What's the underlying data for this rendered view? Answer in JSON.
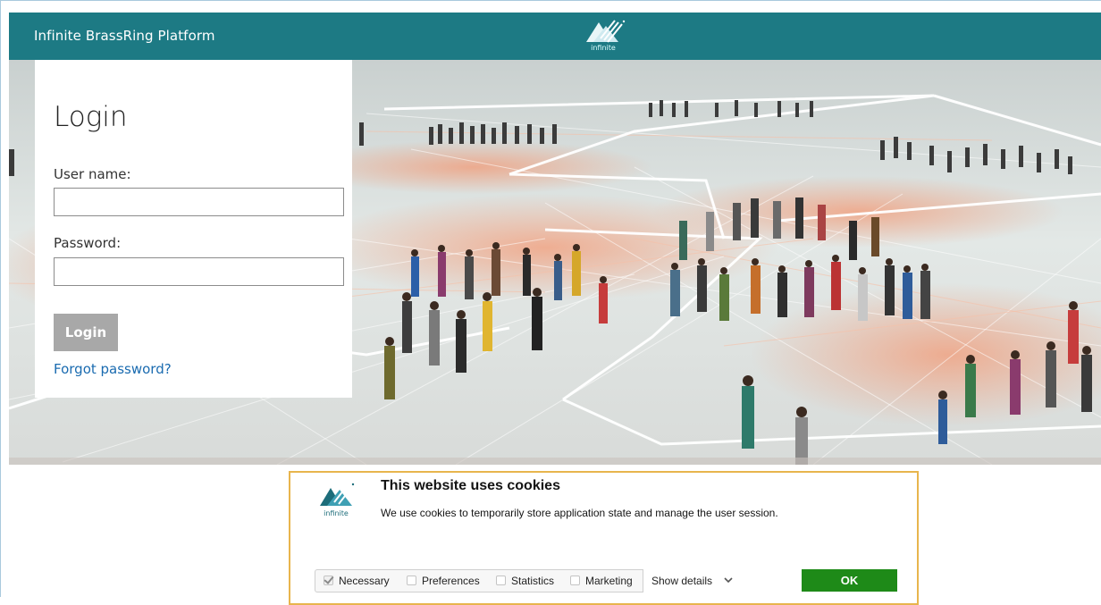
{
  "header": {
    "title": "Infinite BrassRing Platform",
    "logo_text": "infinite",
    "bar_color": "#1d7a84"
  },
  "login": {
    "title": "Login",
    "username_label": "User name:",
    "username_value": "",
    "password_label": "Password:",
    "password_value": "",
    "button_label": "Login",
    "forgot_link": "Forgot password?"
  },
  "cookie_banner": {
    "logo_text": "infinite",
    "title": "This website uses cookies",
    "text": "We use cookies to temporarily store application state and manage the user session.",
    "options": [
      {
        "label": "Necessary",
        "checked": true
      },
      {
        "label": "Preferences",
        "checked": false
      },
      {
        "label": "Statistics",
        "checked": false
      },
      {
        "label": "Marketing",
        "checked": false
      }
    ],
    "show_details_label": "Show details",
    "ok_label": "OK",
    "ok_color": "#1e8a18",
    "border_color": "#e8b54d"
  }
}
